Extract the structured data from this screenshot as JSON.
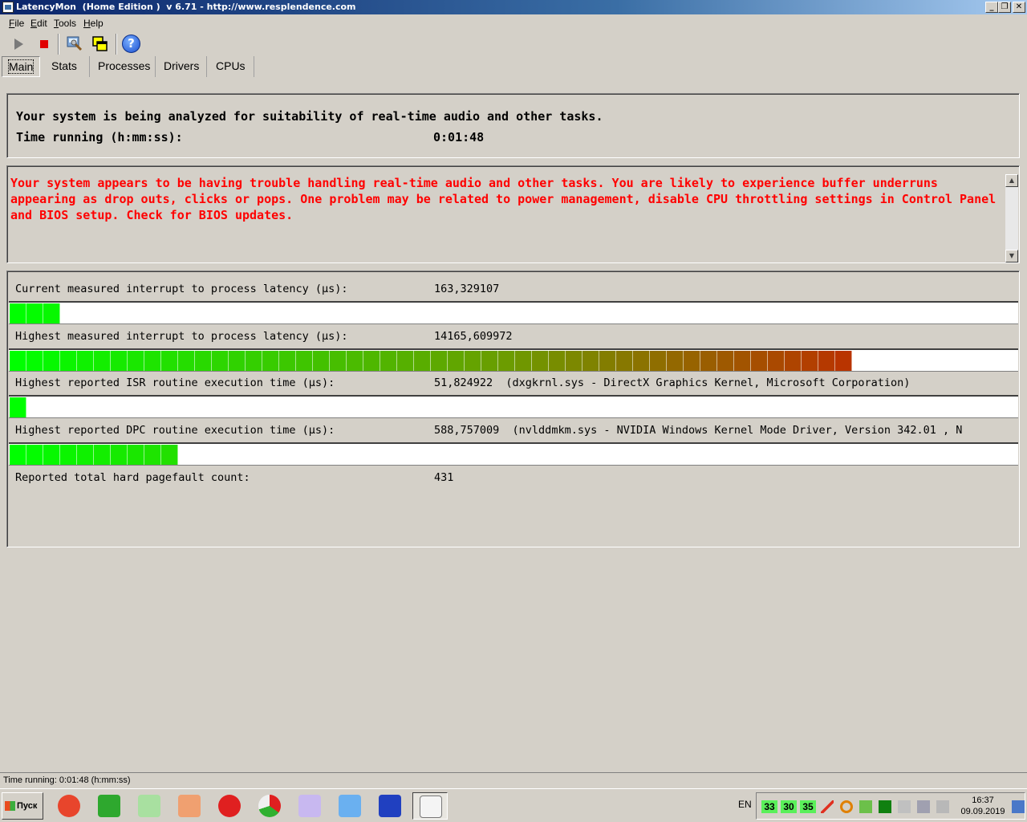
{
  "window": {
    "title": "LatencyMon  (Home Edition )  v 6.71 - http://www.resplendence.com",
    "minimize": "_",
    "restore": "❐",
    "close": "✕"
  },
  "menu": [
    {
      "label": "File",
      "key": "F",
      "rest": "ile"
    },
    {
      "label": "Edit",
      "key": "E",
      "rest": "dit"
    },
    {
      "label": "Tools",
      "key": "T",
      "rest": "ools"
    },
    {
      "label": "Help",
      "key": "H",
      "rest": "elp"
    }
  ],
  "toolbar": {
    "icons": [
      "play-icon",
      "stop-icon",
      "settings-icon",
      "windows-icon",
      "help-icon"
    ],
    "help_glyph": "?"
  },
  "tabs": [
    {
      "label": "Main",
      "active": true
    },
    {
      "label": "Stats",
      "active": false
    },
    {
      "label": "Processes",
      "active": false
    },
    {
      "label": "Drivers",
      "active": false
    },
    {
      "label": "CPUs",
      "active": false
    }
  ],
  "summary": {
    "line1": "Your system is being analyzed for suitability of real-time audio and other tasks.",
    "time_label": "Time running (h:mm:ss):",
    "time_value": "0:01:48"
  },
  "warning": "Your system appears to be having trouble handling real-time audio and other tasks. You are likely to experience buffer underruns appearing as drop outs, clicks or pops. One problem may be related to power management, disable CPU throttling settings in Control Panel and BIOS setup. Check for BIOS updates.",
  "stats": [
    {
      "label": "Current measured interrupt to process latency (µs):",
      "value": "163,329107",
      "detail": "",
      "bar_segments": 3
    },
    {
      "label": "Highest measured interrupt to process latency (µs):",
      "value": "14165,609972",
      "detail": "",
      "bar_segments": 50
    },
    {
      "label": "Highest reported ISR routine execution time (µs):",
      "value": "51,824922",
      "detail": "(dxgkrnl.sys - DirectX Graphics Kernel, Microsoft Corporation)",
      "bar_segments": 1
    },
    {
      "label": "Highest reported DPC routine execution time (µs):",
      "value": "588,757009",
      "detail": "(nvlddmkm.sys - NVIDIA Windows Kernel Mode Driver, Version 342.01 , N",
      "bar_segments": 10
    },
    {
      "label": "Reported total hard pagefault count:",
      "value": "431",
      "detail": "",
      "bar_segments": null
    }
  ],
  "statusbar": "Time running: 0:01:48  (h:mm:ss)",
  "taskbar": {
    "start_label": "Пуск",
    "apps": [
      "power-icon",
      "arrow-icon",
      "notepad-icon",
      "media-icon",
      "record-icon",
      "chart-icon",
      "document-icon",
      "palette-icon",
      "floppy-icon",
      "latencymon-icon"
    ],
    "language": "EN",
    "tray_numbers": [
      "33",
      "30",
      "35"
    ],
    "time": "16:37",
    "date": "09.09.2019"
  },
  "colors": {
    "bar_start": "#00ff00",
    "bar_mid": "#6e9a00",
    "bar_end": "#e00000",
    "warning": "#ff0000"
  }
}
